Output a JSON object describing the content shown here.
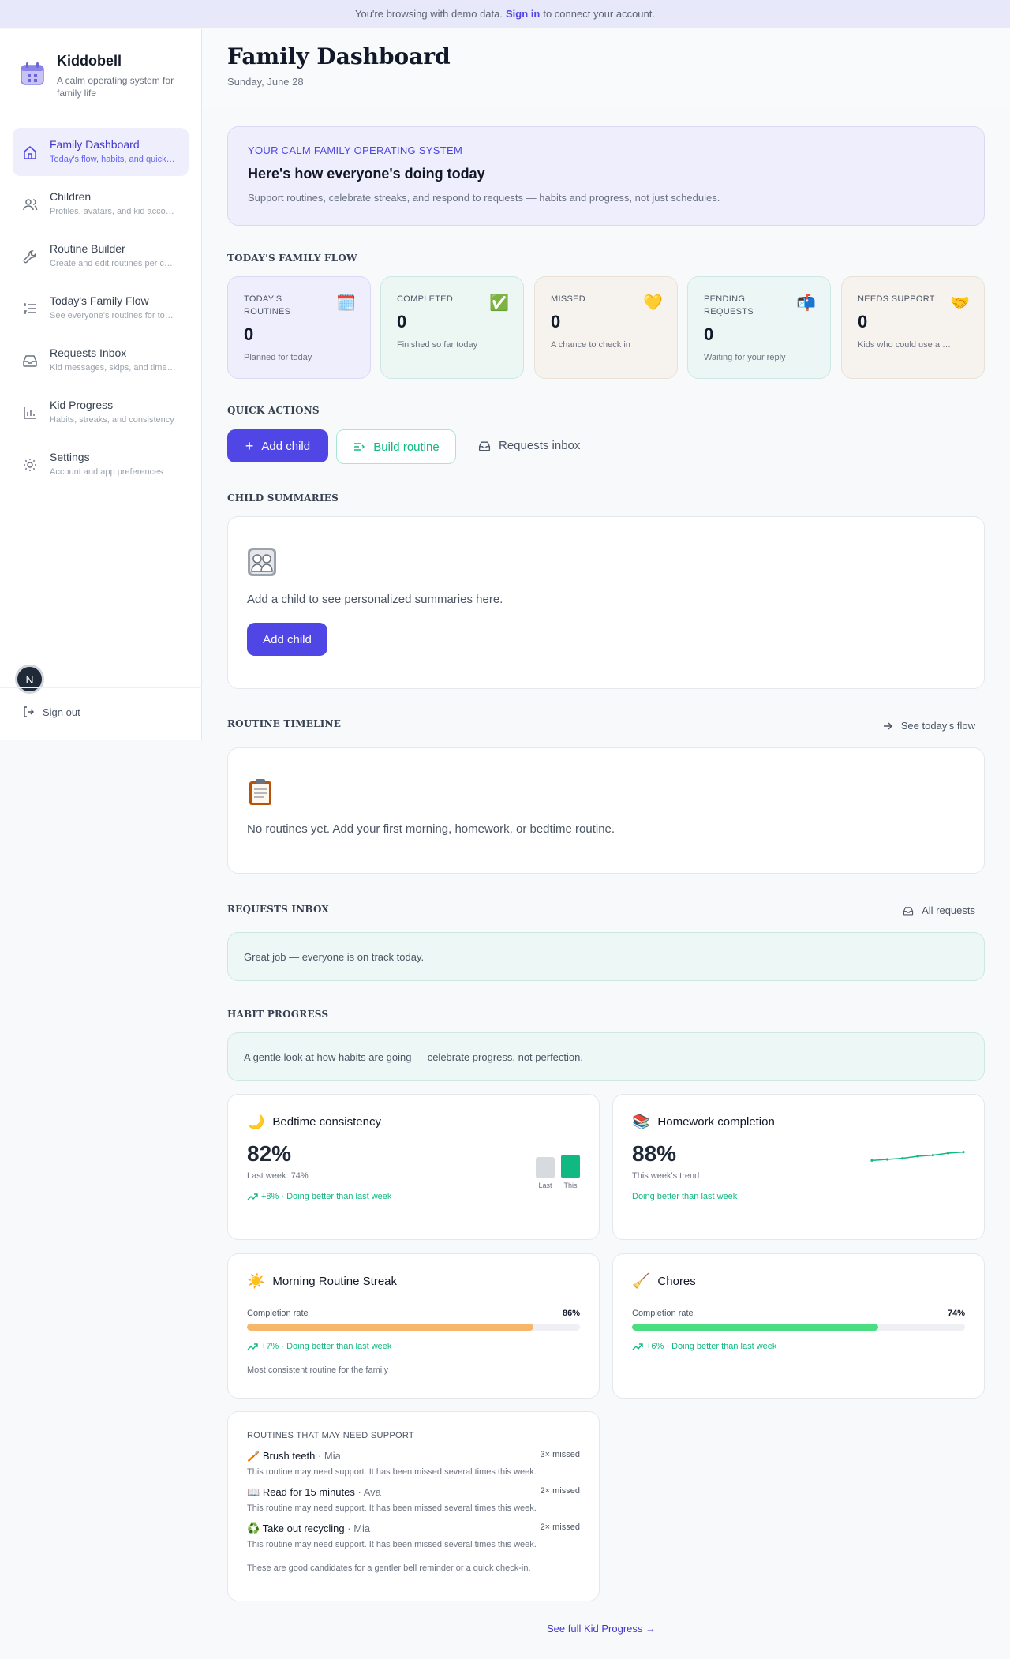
{
  "banner": {
    "prefix": "You're browsing with demo data.",
    "signin": "Sign in",
    "suffix": "to connect your account."
  },
  "brand": {
    "name": "Kiddobell",
    "tagline": "A calm operating system for family life"
  },
  "nav": [
    {
      "label": "Family Dashboard",
      "sub": "Today's flow, habits, and quick actions"
    },
    {
      "label": "Children",
      "sub": "Profiles, avatars, and kid accounts"
    },
    {
      "label": "Routine Builder",
      "sub": "Create and edit routines per child"
    },
    {
      "label": "Today's Family Flow",
      "sub": "See everyone's routines for today"
    },
    {
      "label": "Requests Inbox",
      "sub": "Kid messages, skips, and time requests"
    },
    {
      "label": "Kid Progress",
      "sub": "Habits, streaks, and consistency"
    },
    {
      "label": "Settings",
      "sub": "Account and app preferences"
    }
  ],
  "user": {
    "initial": "N",
    "signout": "Sign out"
  },
  "header": {
    "title": "Family Dashboard",
    "date": "Sunday, June 28"
  },
  "hero": {
    "eyebrow": "YOUR CALM FAMILY OPERATING SYSTEM",
    "title": "Here's how everyone's doing today",
    "subtitle": "Support routines, celebrate streaks, and respond to requests — habits and progress, not just schedules."
  },
  "sections": {
    "flow": "TODAY'S FAMILY FLOW",
    "actions": "QUICK ACTIONS",
    "children": "CHILD SUMMARIES",
    "timeline": "ROUTINE TIMELINE",
    "requests": "REQUESTS INBOX",
    "habits": "HABIT PROGRESS"
  },
  "stats": [
    {
      "label": "Today's routines",
      "value": "0",
      "sub": "Planned for today",
      "emoji": "🗓️",
      "bg": "#eeeefc",
      "border": "#d9d9f4"
    },
    {
      "label": "Completed",
      "value": "0",
      "sub": "Finished so far today",
      "emoji": "✅",
      "bg": "#ecf7f4",
      "border": "#cce8e1"
    },
    {
      "label": "Missed",
      "value": "0",
      "sub": "A chance to check in",
      "emoji": "💛",
      "bg": "#f6f2ee",
      "border": "#ebe0d6"
    },
    {
      "label": "Pending requests",
      "value": "0",
      "sub": "Waiting for your reply",
      "emoji": "📬",
      "bg": "#ecf6f5",
      "border": "#cfe7e3"
    },
    {
      "label": "Needs support",
      "value": "0",
      "sub": "Kids who could use a hand",
      "emoji": "🤝",
      "bg": "#f6f2ee",
      "border": "#ebe0d6"
    }
  ],
  "actions": {
    "add_child": "Add child",
    "build_routine": "Build routine",
    "requests_inbox": "Requests inbox"
  },
  "children": {
    "empty": "Add a child to see personalized summaries here.",
    "button": "Add child"
  },
  "timeline": {
    "link": "See today's flow",
    "empty": "No routines yet. Add your first morning, homework, or bedtime routine."
  },
  "requests": {
    "link": "All requests",
    "notice": "Great job — everyone is on track today."
  },
  "habits": {
    "intro": "A gentle look at how habits are going — celebrate progress, not perfection.",
    "bedtime": {
      "title": "Bedtime consistency",
      "emoji": "🌙",
      "pct": "82%",
      "sub": "Last week: 74%",
      "trend": "+8% · Doing better than last week",
      "last_label": "Last",
      "this_label": "This",
      "last_value": 74,
      "this_value": 82
    },
    "homework": {
      "title": "Homework completion",
      "emoji": "📚",
      "pct": "88%",
      "sub": "This week's trend",
      "trend": "Doing better than last week",
      "trend_values": [
        80,
        81,
        82,
        84,
        85,
        87,
        88
      ]
    },
    "morning": {
      "title": "Morning Routine Streak",
      "emoji": "☀️",
      "rate_label": "Completion rate",
      "rate": "86%",
      "value": 86,
      "color": "#f6b76a",
      "trend": "+7% · Doing better than last week",
      "note": "Most consistent routine for the family"
    },
    "chores": {
      "title": "Chores",
      "emoji": "🧹",
      "rate_label": "Completion rate",
      "rate": "74%",
      "value": 74,
      "color": "#4ade80",
      "trend": "+6% · Doing better than last week"
    },
    "support": {
      "title": "ROUTINES THAT MAY NEED SUPPORT",
      "items": [
        {
          "emoji": "🪥",
          "name": "Brush teeth",
          "kid": "· Mia",
          "missed": "3× missed",
          "desc": "This routine may need support. It has been missed several times this week."
        },
        {
          "emoji": "📖",
          "name": "Read for 15 minutes",
          "kid": "· Ava",
          "missed": "2× missed",
          "desc": "This routine may need support. It has been missed several times this week."
        },
        {
          "emoji": "♻️",
          "name": "Take out recycling",
          "kid": "· Mia",
          "missed": "2× missed",
          "desc": "This routine may need support. It has been missed several times this week."
        }
      ],
      "footer": "These are good candidates for a gentler bell reminder or a quick check-in."
    },
    "full_link": "See full Kid Progress →"
  },
  "colors": {
    "accent": "#4f46e5",
    "success": "#10b981"
  }
}
